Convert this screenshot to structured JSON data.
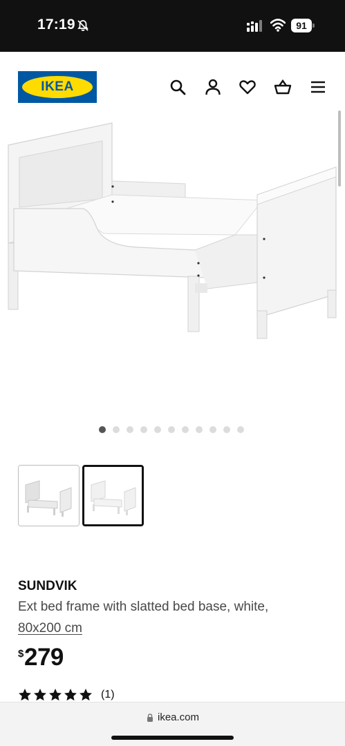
{
  "status_bar": {
    "time": "17:19",
    "battery": "91",
    "icons": [
      "bell-slash-icon",
      "signal-icon",
      "wifi-icon",
      "battery-icon"
    ]
  },
  "header": {
    "logo_text": "IKEA",
    "icons": [
      "search-icon",
      "account-icon",
      "heart-icon",
      "basket-icon",
      "menu-icon"
    ]
  },
  "gallery": {
    "dots_total": 11,
    "active_dot": 0,
    "thumbnails": 2,
    "selected_thumbnail": 1
  },
  "product": {
    "name": "SUNDVIK",
    "description": "Ext bed frame with slatted bed base, white,",
    "size": "80x200 cm",
    "currency": "$",
    "price": "279",
    "rating_stars": 5,
    "rating_count": "(1)"
  },
  "browser": {
    "url": "ikea.com"
  },
  "colors": {
    "ikea_blue": "#0058a3",
    "ikea_yellow": "#ffdb00"
  }
}
